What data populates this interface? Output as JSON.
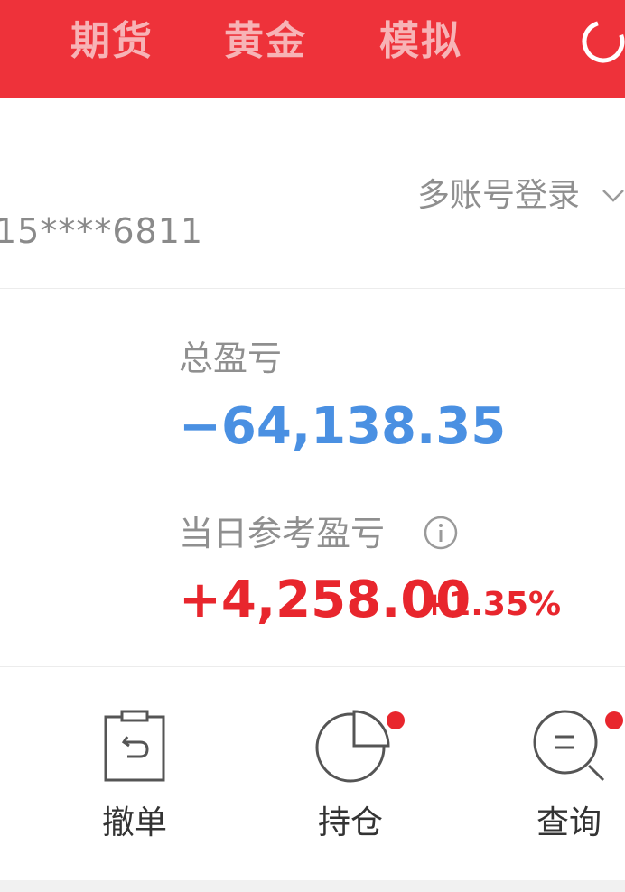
{
  "header": {
    "tabs": [
      {
        "label": "期货"
      },
      {
        "label": "黄金"
      },
      {
        "label": "模拟"
      }
    ],
    "icons": {
      "refresh": "refresh-icon"
    }
  },
  "account": {
    "switch_label": "多账号登录",
    "number": "15****6811"
  },
  "pnl": {
    "total_label": "总盈亏",
    "total_value": "−64,138.35",
    "daily_label": "当日参考盈亏",
    "daily_value": "+4,258.00",
    "daily_percent": "+1.35%"
  },
  "actions": [
    {
      "label": "撤单",
      "icon": "cancel-order-icon"
    },
    {
      "label": "持仓",
      "icon": "pie-chart-icon"
    },
    {
      "label": "查询",
      "icon": "search-icon"
    }
  ],
  "colors": {
    "header_bg": "#ee323a",
    "tab_text": "#f7b3b6",
    "loss_blue": "#4a90e2",
    "gain_red": "#e8262d",
    "muted_text": "#8f8f8f"
  }
}
